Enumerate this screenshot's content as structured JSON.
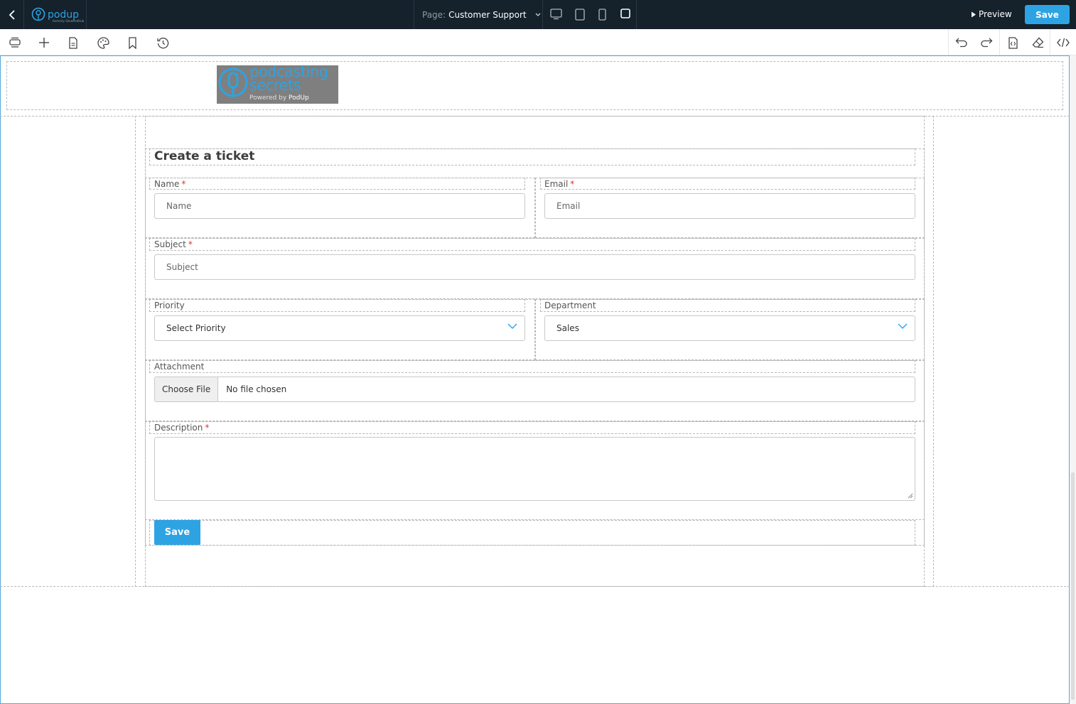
{
  "topbar": {
    "logo_text": "podup",
    "logo_subtext": "formerly ShowPodHub",
    "page_label": "Page:",
    "page_value": "Customer Support",
    "preview_label": "Preview",
    "save_label": "Save",
    "accent_color": "#2ea3e3"
  },
  "toolbar": {
    "left_tools": [
      "layers-icon",
      "add-icon",
      "page-icon",
      "palette-icon",
      "bookmark-icon",
      "history-icon"
    ],
    "right_tools": [
      "undo-icon",
      "redo-icon",
      "export-code-icon",
      "eraser-icon",
      "code-icon"
    ]
  },
  "header_logo": {
    "line1": "podcasting",
    "line2": "secrets",
    "powered_by": "Powered by",
    "powered_brand": "PodUp"
  },
  "form": {
    "title": "Create a ticket",
    "name": {
      "label": "Name",
      "required": "*",
      "placeholder": "Name"
    },
    "email": {
      "label": "Email",
      "required": "*",
      "placeholder": "Email"
    },
    "subject": {
      "label": "Subject",
      "required": "*",
      "placeholder": "Subject"
    },
    "priority": {
      "label": "Priority",
      "value": "Select Priority"
    },
    "department": {
      "label": "Department",
      "value": "Sales"
    },
    "attachment": {
      "label": "Attachment",
      "button": "Choose File",
      "status": "No file chosen"
    },
    "description": {
      "label": "Description",
      "required": "*"
    },
    "submit_label": "Save"
  }
}
